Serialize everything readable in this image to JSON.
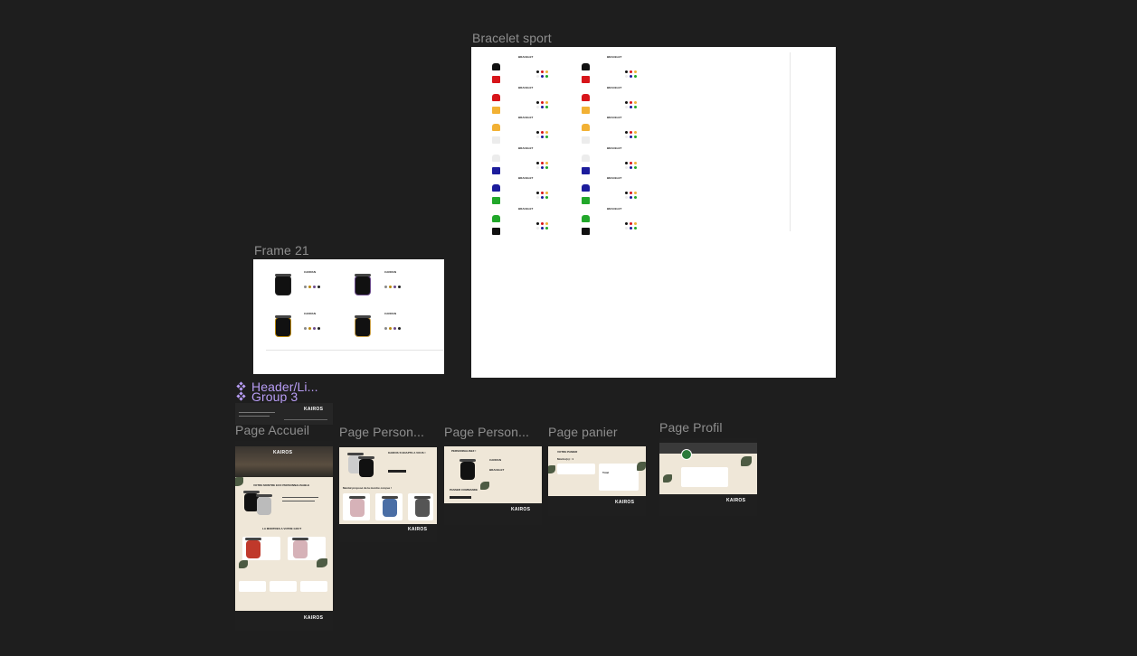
{
  "canvas": {
    "background": "#1e1e1e"
  },
  "frames": {
    "bracelet_sport": {
      "label": "Bracelet sport",
      "item_title": "BRACELET",
      "strap_colors": [
        "#111111",
        "#d7151a",
        "#f2b134",
        "#ececec",
        "#1c1c9c",
        "#21a72a"
      ]
    },
    "frame21": {
      "label": "Frame 21",
      "item_title": "CADRAN"
    },
    "header": {
      "label": "Header/Li..."
    },
    "group3": {
      "label": "Group 3"
    },
    "page_accueil": {
      "label": "Page Accueil",
      "brand": "KAIROS",
      "headline": "VOTRE MONTRE ECO PERSONNALISABLE",
      "section2": "LA MONTRES A VOTRE GOUT"
    },
    "page_perso1": {
      "label": "Page Person...",
      "brand": "KAIROS",
      "headline": "KAIROS S'ADAPTE A VOUS !",
      "section": "Mental proposé de la montre conçue !"
    },
    "page_perso2": {
      "label": "Page Person...",
      "brand": "KAIROS",
      "headline": "PERSONNALISEZ !",
      "cadran": "CADRAN",
      "bracelet": "BRACELET",
      "cta": "PASSER COMMANDE"
    },
    "page_panier": {
      "label": "Page panier",
      "brand": "KAIROS",
      "headline": "VOTRE PANIER",
      "subtitle": "Montre(s) : 1",
      "total": "Total"
    },
    "page_profil": {
      "label": "Page Profil",
      "brand": "KAIROS"
    }
  }
}
